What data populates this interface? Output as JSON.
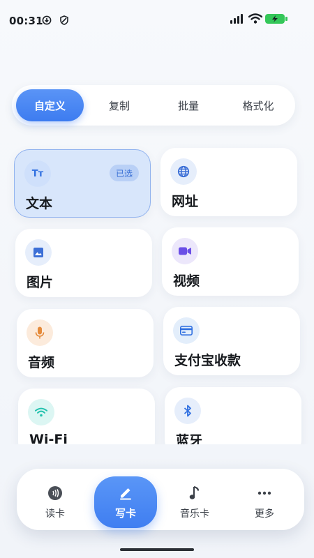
{
  "status_bar": {
    "time": "00:31",
    "battery_color": "#34c759"
  },
  "tabs": [
    {
      "label": "自定义",
      "active": true
    },
    {
      "label": "复制",
      "active": false
    },
    {
      "label": "批量",
      "active": false
    },
    {
      "label": "格式化",
      "active": false
    }
  ],
  "cards": [
    {
      "label": "文本",
      "icon": "text-format-icon",
      "icon_text": "Tт",
      "badge": "已选",
      "selected": true
    },
    {
      "label": "网址",
      "icon": "globe-icon"
    },
    {
      "label": "图片",
      "icon": "image-icon"
    },
    {
      "label": "视频",
      "icon": "video-camera-icon"
    },
    {
      "label": "音频",
      "icon": "microphone-icon"
    },
    {
      "label": "支付宝收款",
      "icon": "payment-card-icon"
    },
    {
      "label": "Wi-Fi",
      "icon": "wifi-icon"
    },
    {
      "label": "蓝牙",
      "icon": "bluetooth-icon"
    }
  ],
  "bottom_nav": [
    {
      "label": "读卡",
      "icon": "nfc-read-icon"
    },
    {
      "label": "写卡",
      "icon": "pen-write-icon",
      "active": true
    },
    {
      "label": "音乐卡",
      "icon": "music-note-icon"
    },
    {
      "label": "更多",
      "icon": "more-dots-icon"
    }
  ],
  "colors": {
    "accent": "#3d7cf0",
    "selected_card_bg": "#d8e6fb",
    "badge_text": "#3c72d6"
  }
}
